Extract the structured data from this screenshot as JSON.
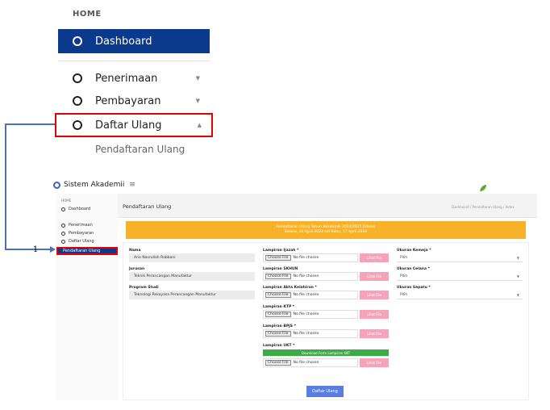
{
  "zoom": {
    "home": "HOME",
    "dashboard": "Dashboard",
    "penerimaan": "Penerimaan",
    "pembayaran": "Pembayaran",
    "daftar_ulang": "Daftar Ulang",
    "pendaftaran_ulang": "Pendaftaran Ulang"
  },
  "callout_number": "1",
  "app": {
    "title": "Sistem Akademii",
    "menu_icon": "≡",
    "sidebar": {
      "home": "HOME",
      "dashboard": "Dashboard",
      "penerimaan": "Penerimaan",
      "pembayaran": "Pembayaran",
      "daftar_ulang": "Daftar Ulang",
      "pendaftaran_ulang": "Pendaftaran Ulang"
    },
    "page_title": "Pendaftaran Ulang",
    "breadcrumb": "Dashboard  /  Pendaftaran Ulang  /  Index",
    "banner_line1": "Pendaftaran Ulang Tahun Akademik 2024/2025 Dibuka",
    "banner_line2": "Selasa, 16 April 2024 s/d Rabu, 17 April 2024",
    "form": {
      "nama_label": "Nama",
      "nama_value": "Arie Nasrullah Rabbani",
      "jurusan_label": "Jurusan",
      "jurusan_value": "Teknik Perancangan Manufaktur",
      "prodi_label": "Program Studi",
      "prodi_value": "Teknologi Rekayasa Perancangan Manufaktur",
      "ijazah_label": "Lampiran Ijazah *",
      "skhun_label": "Lampiran SKHUN",
      "akta_label": "Lampiran Akta Kelahiran *",
      "ktp_label": "Lampiran KTP *",
      "bpjs_label": "Lampiran BPJS *",
      "ukt_label": "Lampiran UKT *",
      "choose_file": "Choose File",
      "no_file": "No file chosen",
      "lihat_file": "Lihat File",
      "download_ukt": "Download Form Lampiran UKT",
      "kemeja_label": "Ukuran Kemeja *",
      "celana_label": "Ukuran Celana *",
      "sepatu_label": "Ukuran Sepatu *",
      "pilih": "Pilih",
      "submit": "Daftar Ulang"
    }
  },
  "colors": {
    "primary": "#0b3a8c",
    "highlight": "#e20000",
    "connector": "#4a72b5",
    "banner": "#f7b22a",
    "pink": "#f5a3b8",
    "green": "#3dab45"
  }
}
